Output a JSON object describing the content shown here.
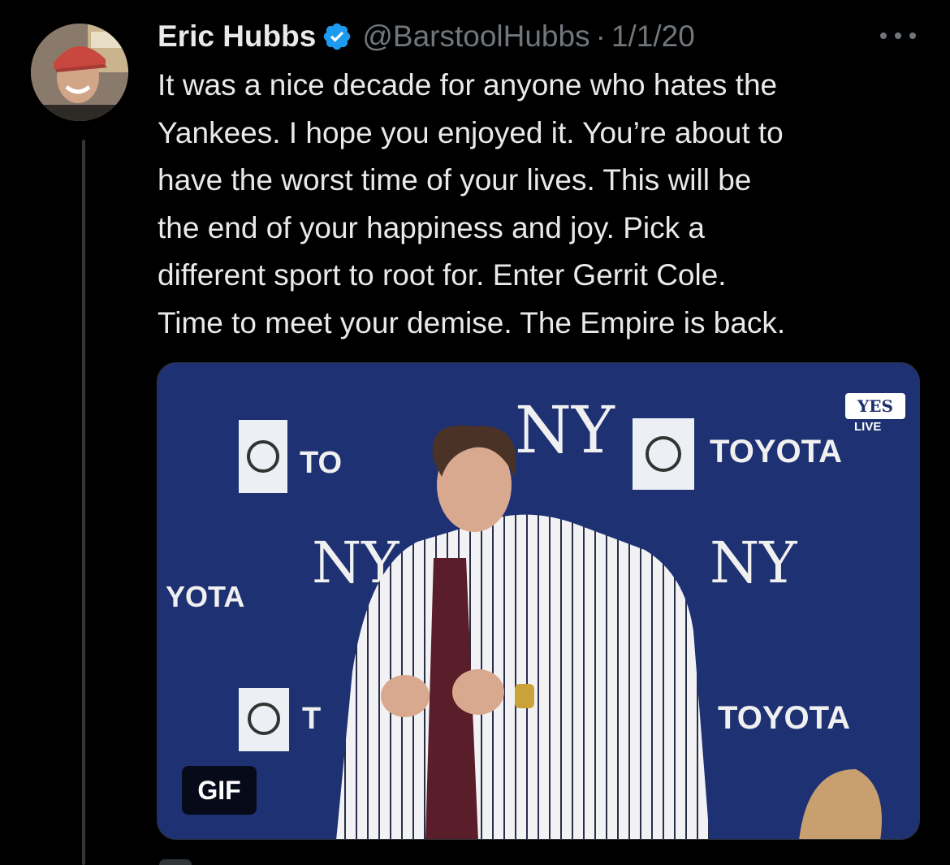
{
  "tweet": {
    "author": {
      "display_name": "Eric Hubbs",
      "handle": "@BarstoolHubbs",
      "verified": true
    },
    "separator": "·",
    "date": "1/1/20",
    "more_icon": "more-icon",
    "text_lines": [
      "It was a nice decade for anyone who hates the",
      "Yankees. I hope you enjoyed it. You’re about to",
      "have the worst time of your lives. This will be",
      "the end of your happiness and joy. Pick a",
      "different sport to root for. Enter Gerrit Cole.",
      "Time to meet your demise. The Empire is back."
    ],
    "media": {
      "badge": "GIF",
      "backdrop_words": [
        "TOYOTA",
        "TO",
        "YOTA",
        "TOYOTA",
        "T"
      ],
      "broadcaster": {
        "logo": "YES",
        "status": "LIVE"
      }
    }
  },
  "colors": {
    "background": "#000000",
    "text": "#e7e9ea",
    "secondary": "#71767b",
    "verified": "#1d9bf0",
    "backdrop": "#1c2f6e"
  }
}
